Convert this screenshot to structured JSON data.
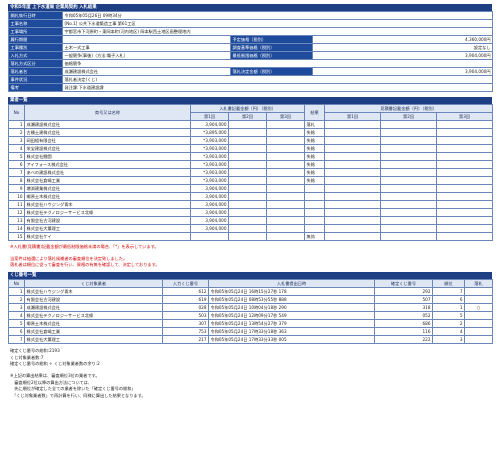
{
  "title": "令和5年度 上下水道局 企業局契約 入札結果",
  "info": {
    "exec_date_label": "開札執行日時",
    "exec_date": "令和05年05月26日 09時34分",
    "project_label": "工事名称",
    "project": "[No.1] 公共下水道築造工事 第61工区",
    "place_label": "工事場所",
    "place": "宇都宮市下河原町・東岡本町(河内地区) 岡本駅西土地区画整理地内",
    "term_label": "履行期間",
    "budget_label": "予定価格（税別）",
    "budget": "4,360,000円",
    "kind_label": "工事種別",
    "kind": "土木一式工事",
    "survey_label": "調査基準価格（税別）",
    "survey": "設定なし",
    "method_label": "入札方式",
    "method": "一般競争(事後)（方法:電子入札）",
    "minlimit_label": "最低制限価格（税別）",
    "minlimit": "3,904,000円",
    "contract_label": "落札方式区分",
    "contract": "価格競争",
    "winner_label": "落札者名",
    "winner": "成瀬建設株式会社",
    "winprice_label": "落札決定金額（税別）",
    "winprice": "3,904,000円",
    "status_label": "事件状況",
    "status": "落札者決定(くじ)",
    "remark_label": "備考",
    "remark": "発注課:下水道建設課"
  },
  "bidders": {
    "section_title": "業者一覧",
    "headers": {
      "no": "No",
      "name": "商号又は名称",
      "amount": "入札書記載金額（円）（税別）",
      "r1": "第1回",
      "r2": "第2回",
      "r3": "第3回",
      "result": "結果",
      "estimate": "見積書記載金額（円）（税別）"
    },
    "rows": [
      {
        "no": "1",
        "name": "成瀬建設株式会社",
        "r1": "3,904,000",
        "result": "落札"
      },
      {
        "no": "2",
        "name": "古橋土建株式会社",
        "r1": "*3,895,000",
        "result": "失格"
      },
      {
        "no": "3",
        "name": "岡田組有限会社",
        "r1": "*3,903,000",
        "result": "失格"
      },
      {
        "no": "4",
        "name": "栄宝建設株式会社",
        "r1": "*3,903,000",
        "result": "失格"
      },
      {
        "no": "5",
        "name": "株式会社鯉園",
        "r1": "*3,903,000",
        "result": "失格"
      },
      {
        "no": "6",
        "name": "アイフォース株式会社",
        "r1": "*3,903,000",
        "result": "失格"
      },
      {
        "no": "7",
        "name": "あべの建設株式会社",
        "r1": "*3,903,000",
        "result": "失格"
      },
      {
        "no": "8",
        "name": "株式会社倉嶋工業",
        "r1": "*3,903,000",
        "result": "失格"
      },
      {
        "no": "9",
        "name": "増渕建業株式会社",
        "r1": "3,904,000",
        "result": ""
      },
      {
        "no": "10",
        "name": "郷原土木株式会社",
        "r1": "3,904,000",
        "result": ""
      },
      {
        "no": "11",
        "name": "株式会社ハウジング青木",
        "r1": "3,904,000",
        "result": ""
      },
      {
        "no": "12",
        "name": "株式会社テクノロジーサービス北條",
        "r1": "3,904,000",
        "result": ""
      },
      {
        "no": "13",
        "name": "有限会社古河建設",
        "r1": "3,904,000",
        "result": ""
      },
      {
        "no": "14",
        "name": "株式会社大薫理工",
        "r1": "3,904,000",
        "result": ""
      },
      {
        "no": "15",
        "name": "株式会社ケイ",
        "r1": "",
        "result": "無効"
      }
    ]
  },
  "note1": "※入札書(見積書)記載金額が最低制限価格未満の場合、「*」を表示しています。",
  "note2a": "当案件は抽選により落札候補者の審査順位を決定致しました。",
  "note2b": "落札者は順位に従って審査を行い、資格の有無を確認して、決定しております。",
  "lottery": {
    "section_title": "くじ番号一覧",
    "headers": {
      "no": "No",
      "name": "くじ対象業者",
      "kuji": "入力くじ番号",
      "datetime": "入札書提出日時",
      "kakutei": "確定くじ番号",
      "order": "順位",
      "win": "落札"
    },
    "rows": [
      {
        "no": "1",
        "name": "株式会社ハウジング青木",
        "kuji": "612",
        "datetime": "令和05年05月24日 16時15分27秒 178",
        "kakutei": "292",
        "order": "7",
        "win": ""
      },
      {
        "no": "2",
        "name": "有限会社古河建設",
        "kuji": "619",
        "datetime": "令和05年05月24日 08時53分55秒 888",
        "kakutei": "507",
        "order": "6",
        "win": ""
      },
      {
        "no": "3",
        "name": "成瀬建設株式会社",
        "kuji": "028",
        "datetime": "令和05年05月24日 10時04分18秒 290",
        "kakutei": "318",
        "order": "1",
        "win": "○"
      },
      {
        "no": "4",
        "name": "株式会社テクノロジーサービス北條",
        "kuji": "503",
        "datetime": "令和05年05月24日 12時09分17秒 549",
        "kakutei": "052",
        "order": "5",
        "win": ""
      },
      {
        "no": "5",
        "name": "郷原土木株式会社",
        "kuji": "307",
        "datetime": "令和05年05月24日 13時54分27秒 379",
        "kakutei": "686",
        "order": "2",
        "win": ""
      },
      {
        "no": "6",
        "name": "株式会社倉嶋工業",
        "kuji": "753",
        "datetime": "令和05年05月24日 17時33分18秒 363",
        "kakutei": "116",
        "order": "4",
        "win": ""
      },
      {
        "no": "7",
        "name": "株式会社大薫理工",
        "kuji": "217",
        "datetime": "令和05年05月24日 17時33分33秒 005",
        "kakutei": "222",
        "order": "3",
        "win": ""
      }
    ]
  },
  "footer": {
    "l1": "確定くじ番号の総和:2193",
    "l2": "くじ対象業者数:7",
    "l3": "確定くじ番号の総和 ÷ くじ対象業者数の余り:2",
    "l4": "※上記の算出結果は、審査順位3位の業者です。",
    "l5": "　審査順位2位以降の算出方法については、",
    "l6": "　先に順位が確定した全ての業者を除いた「確定くじ番号の総和」",
    "l7": "　「くじ対象業者数」で再計算を行い、同様に算出した結果となります。"
  }
}
